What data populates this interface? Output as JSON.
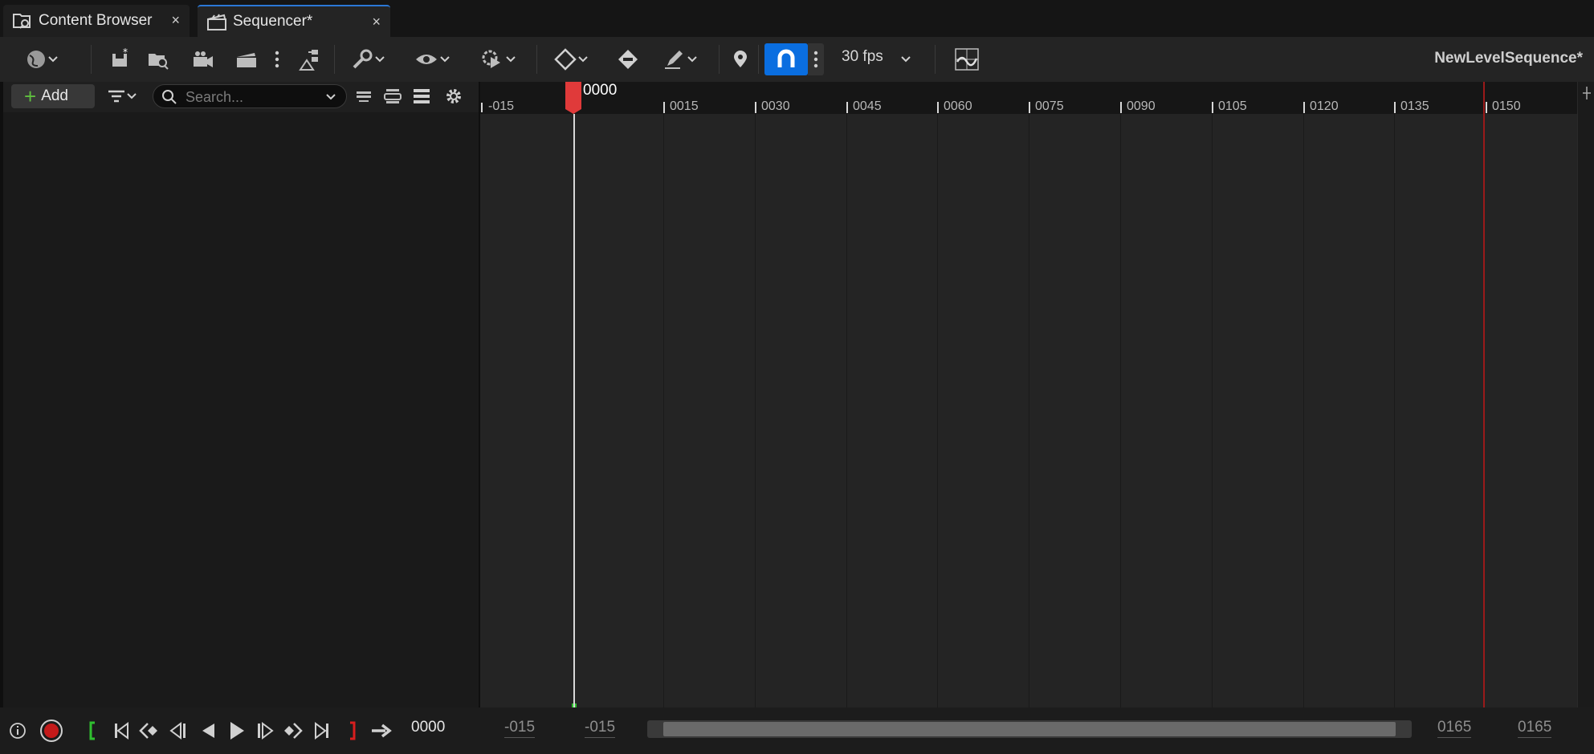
{
  "tabs": [
    {
      "label": "Content Browser",
      "icon": "content-browser-icon",
      "close": "×"
    },
    {
      "label": "Sequencer*",
      "icon": "clapperboard-icon",
      "close": "×"
    }
  ],
  "toolbar": {
    "fps_label": "30 fps",
    "sequence_name": "NewLevelSequence*",
    "snap_active": true
  },
  "outliner": {
    "add_label": "Add",
    "search_placeholder": "Search..."
  },
  "timeline": {
    "playhead_frame": "0000",
    "ticks": [
      "-015",
      "0015",
      "0030",
      "0045",
      "0060",
      "0075",
      "0090",
      "0105",
      "0120",
      "0135",
      "0150"
    ]
  },
  "transport": {
    "current_frame": "0000",
    "view_start": "-015",
    "working_start": "-015",
    "working_end": "0165",
    "view_end": "0165"
  },
  "colors": {
    "accent": "#0a6ee0",
    "playhead": "#e03a3a",
    "end_marker": "#9a1a1a",
    "start_marker": "#2fbf2f"
  }
}
